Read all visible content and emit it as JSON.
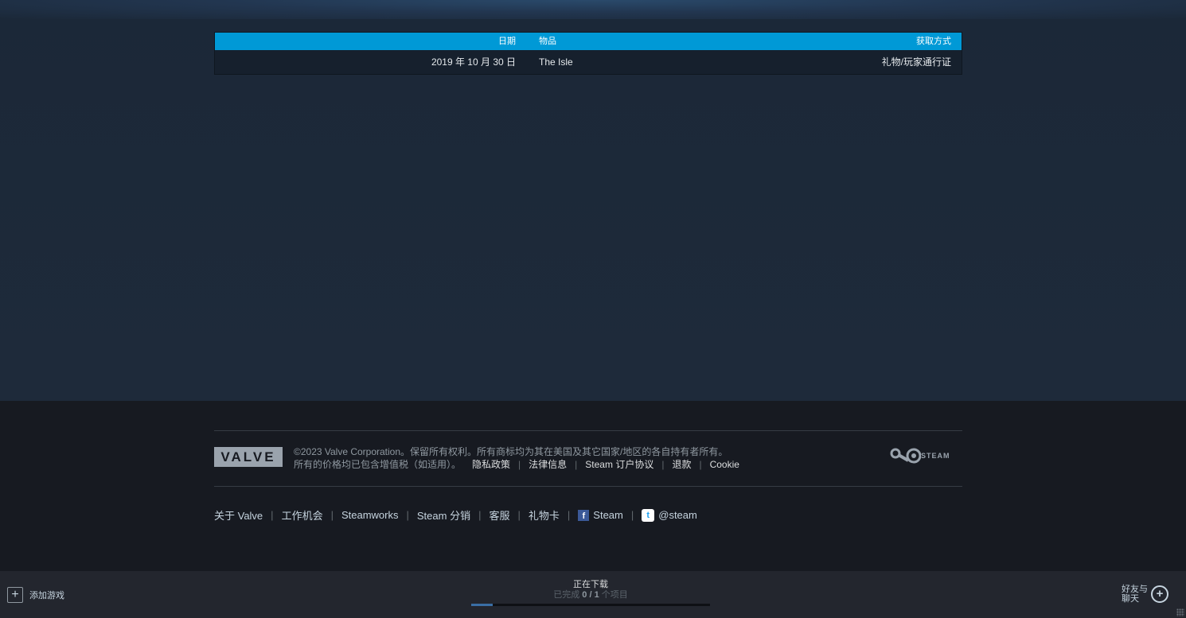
{
  "licenses_table": {
    "headers": {
      "date": "日期",
      "item": "物品",
      "method": "获取方式"
    },
    "rows": [
      {
        "date": "2019 年 10 月 30 日",
        "item": "The Isle",
        "method": "礼物/玩家通行证"
      }
    ]
  },
  "footer": {
    "valve_logo_text": "VALVE",
    "copyright": "©2023 Valve Corporation。保留所有权利。所有商标均为其在美国及其它国家/地区的各自持有者所有。",
    "vat_note": "所有的价格均已包含增值税（如适用）。",
    "policy_links": [
      "隐私政策",
      "法律信息",
      "Steam 订户协议",
      "退款",
      "Cookie"
    ],
    "steam_logo_text": "STEAM",
    "links": [
      "关于 Valve",
      "工作机会",
      "Steamworks",
      "Steam 分销",
      "客服",
      "礼物卡"
    ],
    "social": {
      "facebook": "Steam",
      "twitter": "@steam"
    }
  },
  "bottom_bar": {
    "add_game": "添加游戏",
    "download_title": "正在下载",
    "download_prefix": "已完成 ",
    "download_count": "0 / 1",
    "download_suffix": " 个项目",
    "download_progress": 0.09,
    "friends_line1": "好友与",
    "friends_line2": "聊天"
  },
  "colors": {
    "header_blue": "#0099d6",
    "background": "#1b2838",
    "footer_bg": "#171a21"
  }
}
